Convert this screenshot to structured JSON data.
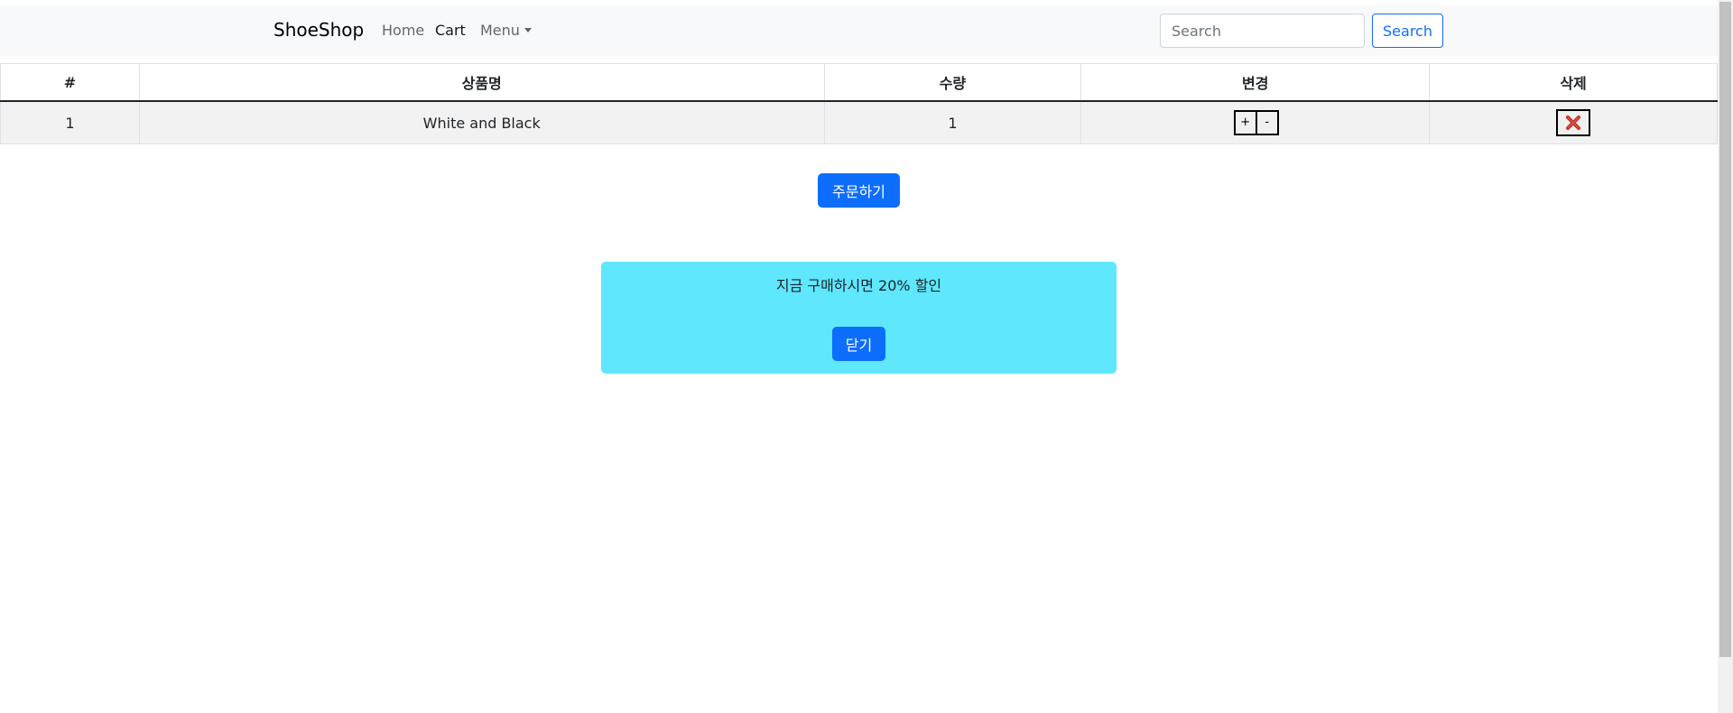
{
  "navbar": {
    "brand": "ShoeShop",
    "links": [
      {
        "label": "Home"
      },
      {
        "label": "Cart"
      },
      {
        "label": "Menu"
      }
    ],
    "search": {
      "placeholder": "Search",
      "value": "",
      "button_label": "Search"
    }
  },
  "cart_table": {
    "headers": [
      "#",
      "상품명",
      "수량",
      "변경",
      "삭제"
    ],
    "rows": [
      {
        "index": "1",
        "name": "White and Black",
        "quantity": "1",
        "increase_label": "+",
        "decrease_label": "-"
      }
    ]
  },
  "order_button": "주문하기",
  "promo": {
    "message": "지금 구매하시면 20% 할인",
    "close_label": "닫기",
    "background": "#5ee7fd"
  },
  "colors": {
    "primary": "#0d6efd",
    "navbar_bg": "#f8f9fa",
    "row_bg": "#f2f2f2",
    "delete_icon": "#c0281c"
  },
  "icons": {
    "delete": "red-x-icon",
    "menu_caret": "chevron-down-icon"
  }
}
